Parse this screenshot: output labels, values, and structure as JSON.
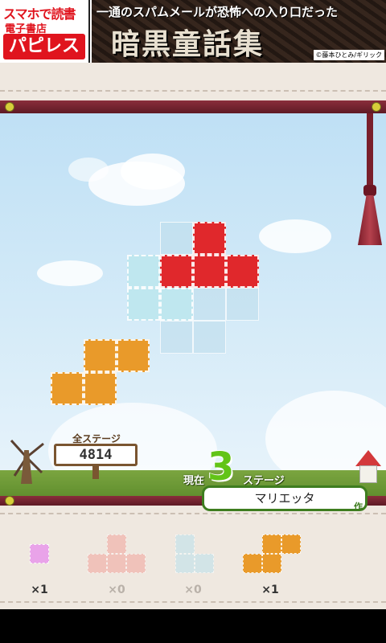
{
  "ad": {
    "line1": "スマホで読書",
    "line2": "電子書店",
    "logo": "パピレス",
    "tagline": "一通のスパムメールが恐怖への入り口だった",
    "title": "暗黒童話集",
    "credit": "©藤本ひとみ/ギリック"
  },
  "stage": {
    "total_label": "全ステージ",
    "total_count": "4814",
    "current_prefix": "現在",
    "current_number": "3",
    "current_suffix": "ステージ"
  },
  "author": {
    "name": "マリエッタ",
    "suffix": "作"
  },
  "tray": [
    {
      "piece": "pink-single",
      "count": "×1"
    },
    {
      "piece": "salmon-t",
      "count": "×0"
    },
    {
      "piece": "lightblue-l",
      "count": "×0"
    },
    {
      "piece": "orange-s",
      "count": "×1"
    }
  ],
  "colors": {
    "red_piece": "#e0282c",
    "cyan_piece": "#bfe7ef",
    "orange_piece": "#e99a2a",
    "accent_green": "#62c417",
    "rod": "#7a1f2b"
  }
}
